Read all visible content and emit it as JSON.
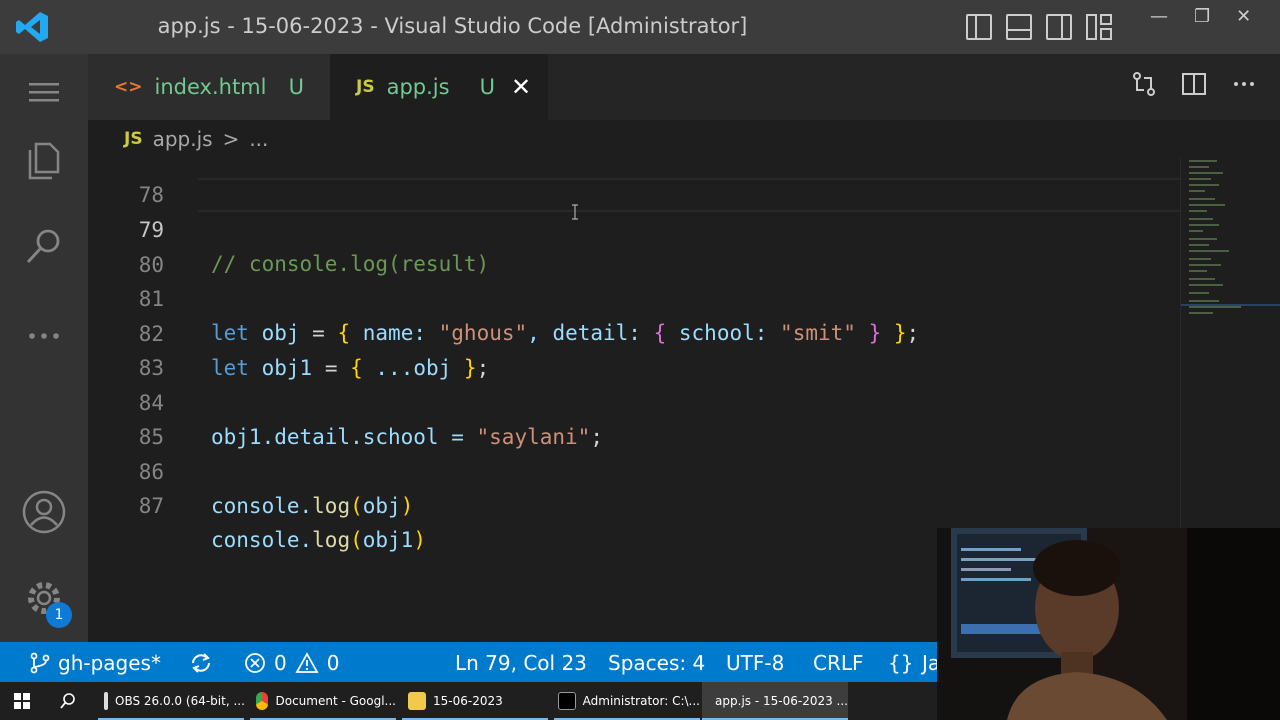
{
  "window": {
    "title": "app.js - 15-06-2023 - Visual Studio Code [Administrator]",
    "controls": [
      "—",
      "❐",
      "✕"
    ]
  },
  "tabs": [
    {
      "icon": "<>",
      "label": "index.html",
      "status": "U"
    },
    {
      "icon": "JS",
      "label": "app.js",
      "status": "U",
      "active": true,
      "close": "✕"
    }
  ],
  "breadcrumb": {
    "icon": "JS",
    "file": "app.js",
    "separator": ">",
    "more": "..."
  },
  "editor": {
    "partial_line_number": "78",
    "lines": [
      {
        "num": "79",
        "active": true
      },
      {
        "num": "80"
      },
      {
        "num": "81"
      },
      {
        "num": "82"
      },
      {
        "num": "83"
      },
      {
        "num": "84"
      },
      {
        "num": "85"
      },
      {
        "num": "86"
      },
      {
        "num": "87"
      }
    ],
    "tokens": {
      "l79_comment": "// console.log(result)",
      "let": "let",
      "obj": "obj",
      "eq": " = ",
      "lbrace": "{",
      "rbrace": "}",
      "name_key": " name: ",
      "ghous": "\"ghous\"",
      "detail_key": ", detail: ",
      "school_key": " school: ",
      "smit": "\"smit\"",
      "space": " ",
      "semi": ";",
      "obj1": "obj1",
      "spread": " ...obj ",
      "path84": "obj1.detail.school = ",
      "saylani": "\"saylani\"",
      "console": "console.",
      "log": "log",
      "lparen": "(",
      "rparen": ")"
    }
  },
  "activity_bar": {
    "icons": [
      "menu-icon",
      "files-icon",
      "search-icon",
      "more-icon",
      "account-icon",
      "manage-gear-icon"
    ],
    "badge": "1"
  },
  "statusbar": {
    "branch": "gh-pages*",
    "errors": "0",
    "warnings": "0",
    "position": "Ln 79, Col 23",
    "spaces": "Spaces: 4",
    "encoding": "UTF-8",
    "eol": "CRLF",
    "language_partial": "Ja"
  },
  "taskbar": {
    "items": [
      {
        "label": "OBS 26.0.0 (64-bit, ..."
      },
      {
        "label": "Document - Googl..."
      },
      {
        "label": "15-06-2023"
      },
      {
        "label": "Administrator: C:\\..."
      },
      {
        "label": "app.js - 15-06-2023 ...",
        "active": true
      }
    ]
  },
  "colors": {
    "accent": "#007acc",
    "comment": "#6a9955",
    "keyword": "#569cd6",
    "variable": "#9cdcfe",
    "string": "#ce9178",
    "function": "#dcdcaa",
    "bracket1": "#ffd700",
    "bracket2": "#da70d6",
    "untracked": "#73c991"
  }
}
